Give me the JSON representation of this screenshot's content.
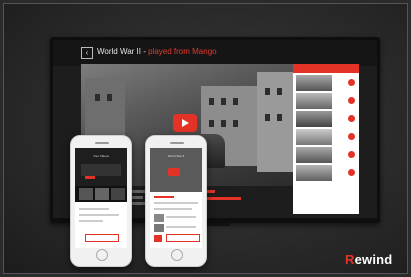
{
  "tv": {
    "back_icon": "chevron-left-icon",
    "title_main": "World War II - ",
    "title_accent": "played from Mango",
    "play_icon": "play-icon"
  },
  "phones": [
    {
      "header": "Your Videos"
    },
    {
      "header": "World War II"
    }
  ],
  "brand": {
    "logo_accent": "R",
    "logo_rest": "ewind",
    "accent_color": "#e53227"
  }
}
